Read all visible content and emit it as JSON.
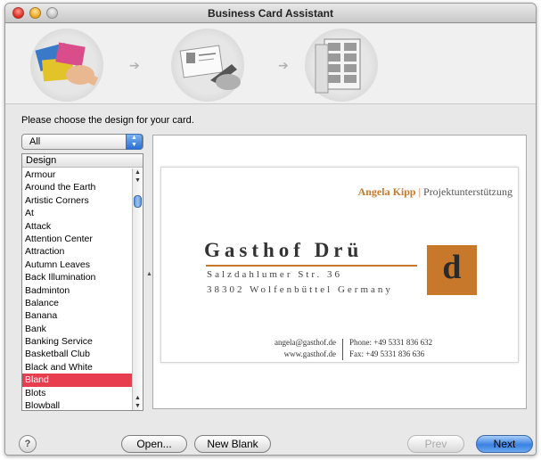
{
  "window": {
    "title": "Business Card Assistant"
  },
  "steps": [
    {
      "icon": "choose-card-design-icon"
    },
    {
      "icon": "edit-card-details-icon"
    },
    {
      "icon": "print-cards-sheet-icon"
    }
  ],
  "prompt": "Please choose the design for your card.",
  "filter": {
    "selected": "All"
  },
  "design_list": {
    "header": "Design",
    "items": [
      "Armour",
      "Around the Earth",
      "Artistic Corners",
      "At",
      "Attack",
      "Attention Center",
      "Attraction",
      "Autumn Leaves",
      "Back Illumination",
      "Badminton",
      "Balance",
      "Banana",
      "Bank",
      "Banking Service",
      "Basketball Club",
      "Black and White",
      "Bland",
      "Blots",
      "Blowball"
    ],
    "selected": "Bland"
  },
  "card": {
    "name": "Angela Kipp",
    "separator": "|",
    "title": "Projektunterstützung",
    "company": "Gasthof Drü",
    "street": "Salzdahlumer Str. 36",
    "city": "38302 Wolfenbüttel Germany",
    "logo_letters": "d",
    "email": "angela@gasthof.de",
    "web": "www.gasthof.de",
    "phone": "Phone: +49 5331 836 632",
    "fax": "Fax: +49 5331 836 636",
    "accent_color": "#c8782b"
  },
  "buttons": {
    "help": "?",
    "open": "Open...",
    "new_blank": "New Blank",
    "prev": "Prev",
    "next": "Next"
  }
}
